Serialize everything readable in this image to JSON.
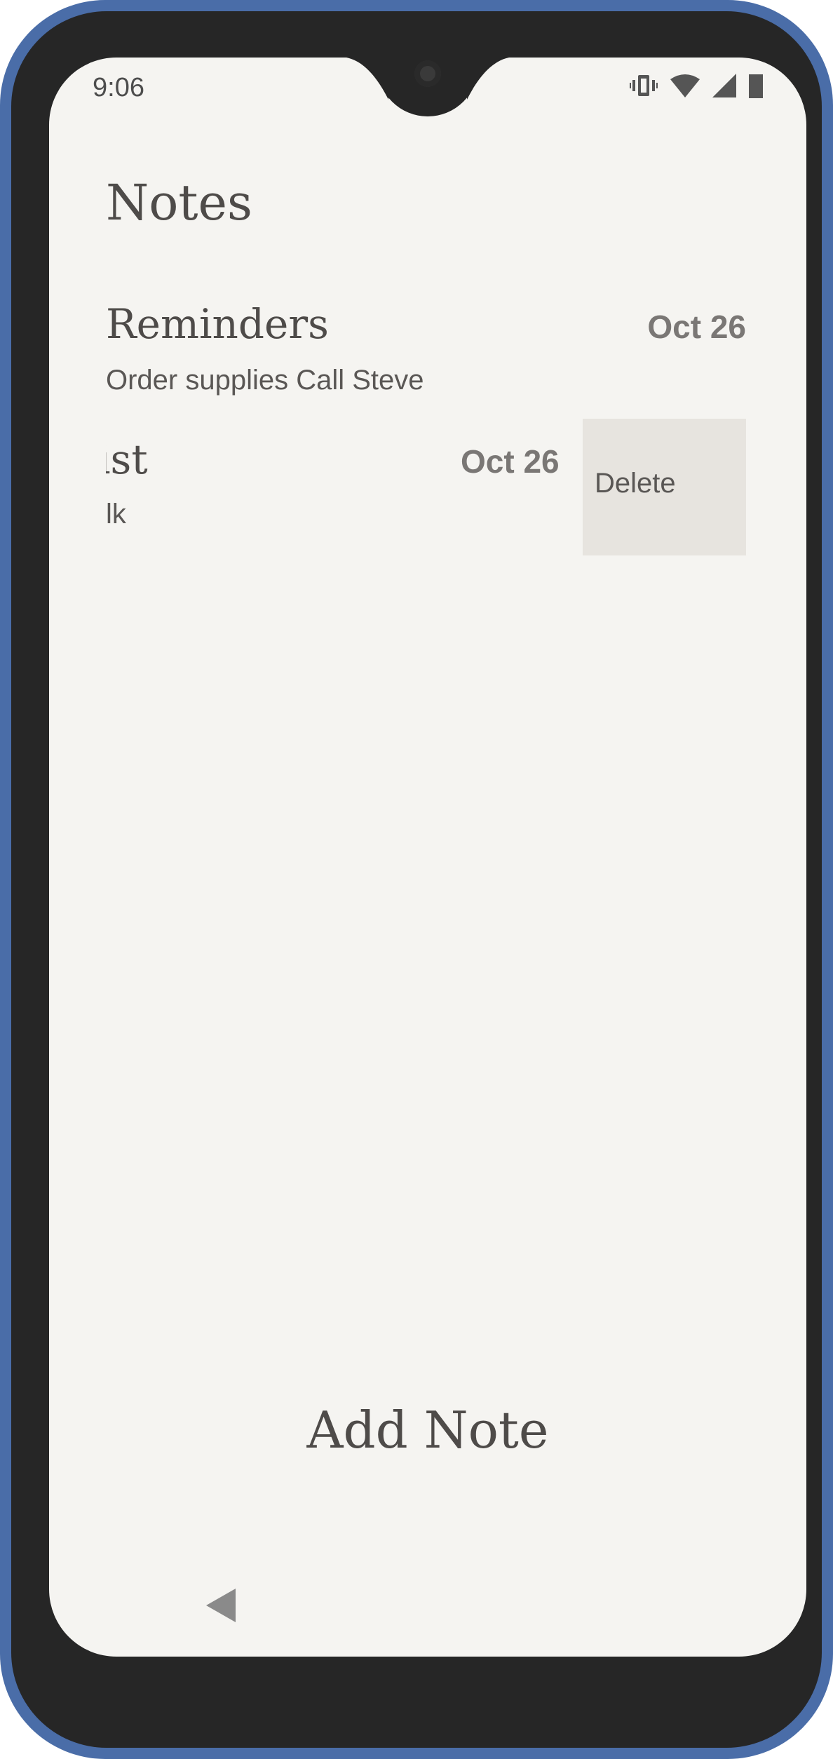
{
  "status_bar": {
    "time": "9:06",
    "icons": [
      "vibrate-icon",
      "wifi-icon",
      "signal-icon",
      "battery-icon"
    ]
  },
  "app": {
    "title": "Notes"
  },
  "notes": [
    {
      "title": "Reminders",
      "date": "Oct 26",
      "preview": "Order supplies  Call Steve"
    },
    {
      "title": "ist",
      "date": "Oct 26",
      "preview": "lk",
      "swiped": true
    }
  ],
  "swipe_action": {
    "delete_label": "Delete"
  },
  "footer": {
    "add_note_label": "Add Note"
  },
  "nav": {
    "back": "back-icon"
  },
  "colors": {
    "frame": "#4a6da8",
    "screen_bg": "#f5f4f1",
    "delete_bg": "#e7e4df",
    "text": "#4e4b49"
  }
}
